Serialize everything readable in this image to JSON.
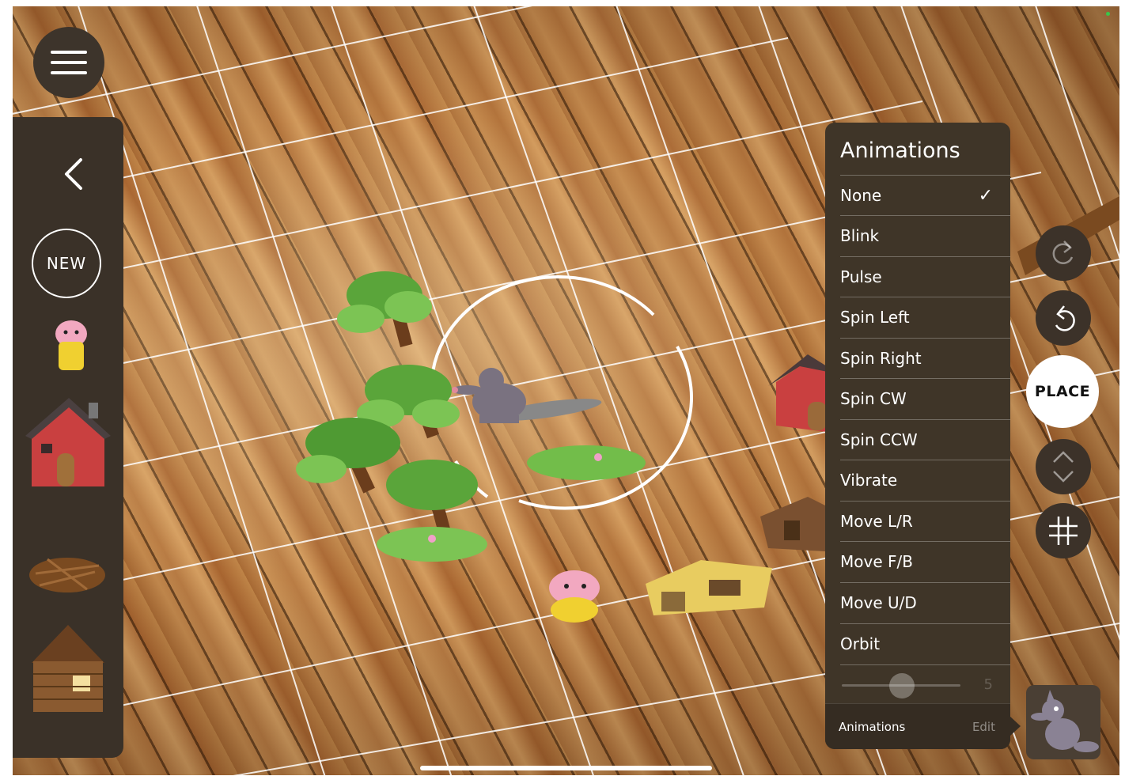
{
  "sidebar": {
    "new_label": "NEW",
    "items": [
      {
        "name": "pig"
      },
      {
        "name": "brick-house"
      },
      {
        "name": "stick-pile"
      },
      {
        "name": "stick-house"
      }
    ]
  },
  "animations_panel": {
    "title": "Animations",
    "selected": "None",
    "items": [
      {
        "label": "None"
      },
      {
        "label": "Blink"
      },
      {
        "label": "Pulse"
      },
      {
        "label": "Spin Left"
      },
      {
        "label": "Spin Right"
      },
      {
        "label": "Spin CW"
      },
      {
        "label": "Spin CCW"
      },
      {
        "label": "Vibrate"
      },
      {
        "label": "Move L/R"
      },
      {
        "label": "Move F/B"
      },
      {
        "label": "Move U/D"
      },
      {
        "label": "Orbit"
      }
    ],
    "slider_value": "5",
    "footer_left": "Animations",
    "footer_right": "Edit"
  },
  "right_controls": {
    "place_label": "PLACE"
  },
  "icons": [
    "menu-icon",
    "back-chevron-icon",
    "redo-icon",
    "undo-icon",
    "vertical-move-icon",
    "grid-icon",
    "checkmark-icon"
  ],
  "colors": {
    "panel": "#3f3528",
    "sidebar": "#3a3128",
    "button": "#3c3229"
  }
}
